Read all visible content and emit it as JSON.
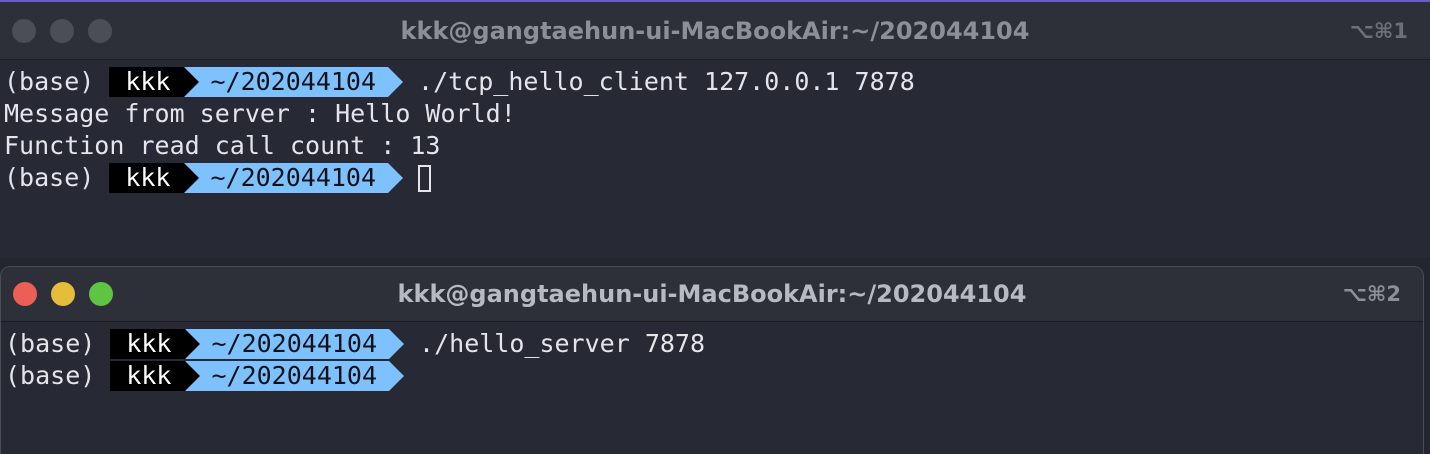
{
  "windows": [
    {
      "title": "kkk@gangtaehun-ui-MacBookAir:~/202044104",
      "shortcut": "⌥⌘1",
      "lines": [
        {
          "kind": "prompt",
          "env": "(base)",
          "user": "kkk",
          "dir": "~/202044104",
          "command": "./tcp_hello_client 127.0.0.1 7878"
        },
        {
          "kind": "output",
          "text": "Message from server : Hello World!"
        },
        {
          "kind": "output",
          "text": "Function read call count : 13"
        },
        {
          "kind": "prompt",
          "env": "(base)",
          "user": "kkk",
          "dir": "~/202044104",
          "command": ""
        }
      ]
    },
    {
      "title": "kkk@gangtaehun-ui-MacBookAir:~/202044104",
      "shortcut": "⌥⌘2",
      "lines": [
        {
          "kind": "prompt",
          "env": "(base)",
          "user": "kkk",
          "dir": "~/202044104",
          "command": "./hello_server 7878"
        },
        {
          "kind": "prompt",
          "env": "(base)",
          "user": "kkk",
          "dir": "~/202044104",
          "command": ""
        }
      ]
    }
  ],
  "colors": {
    "prompt_user_bg": "#000000",
    "prompt_dir_bg": "#7dc2ff",
    "close": "#ec5f57",
    "minimize": "#e5bd3b",
    "zoom": "#5ec443"
  }
}
